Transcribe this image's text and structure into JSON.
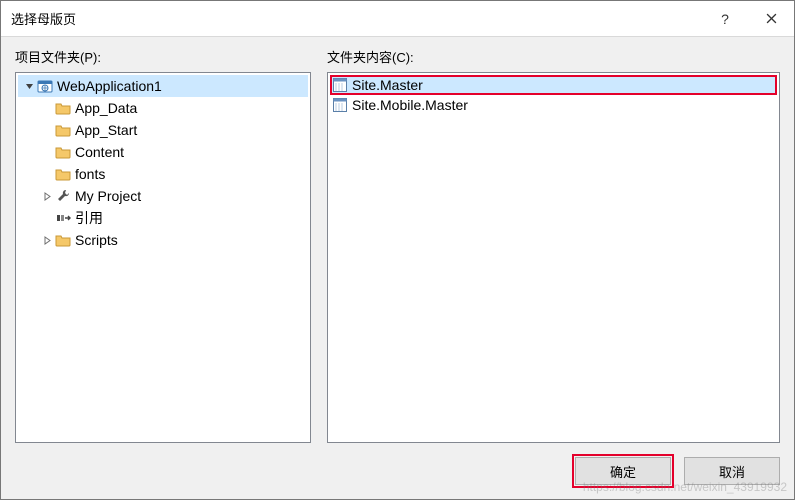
{
  "window": {
    "title": "选择母版页",
    "help_label": "?",
    "close_label": "✕"
  },
  "left": {
    "label": "项目文件夹(P):",
    "tree": [
      {
        "name": "WebApplication1",
        "level": 0,
        "exp": "open",
        "icon": "web",
        "selected": true
      },
      {
        "name": "App_Data",
        "level": 1,
        "exp": "none",
        "icon": "folder"
      },
      {
        "name": "App_Start",
        "level": 1,
        "exp": "none",
        "icon": "folder"
      },
      {
        "name": "Content",
        "level": 1,
        "exp": "none",
        "icon": "folder"
      },
      {
        "name": "fonts",
        "level": 1,
        "exp": "none",
        "icon": "folder"
      },
      {
        "name": "My Project",
        "level": 1,
        "exp": "closed",
        "icon": "wrench"
      },
      {
        "name": "引用",
        "level": 1,
        "exp": "none",
        "icon": "ref"
      },
      {
        "name": "Scripts",
        "level": 1,
        "exp": "closed",
        "icon": "folder"
      }
    ]
  },
  "right": {
    "label": "文件夹内容(C):",
    "items": [
      {
        "name": "Site.Master",
        "selected": true,
        "highlight": true
      },
      {
        "name": "Site.Mobile.Master",
        "selected": false,
        "highlight": false
      }
    ]
  },
  "buttons": {
    "ok": "确定",
    "cancel": "取消"
  },
  "watermark": "https://blog.csdn.net/weixin_43919932"
}
